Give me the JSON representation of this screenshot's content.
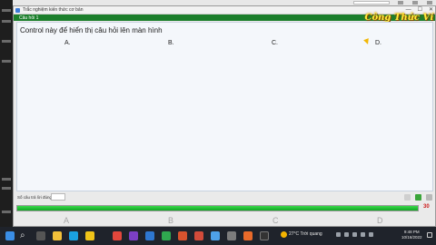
{
  "window": {
    "title": "Trắc nghiệm kiến thức cơ bản",
    "controls": {
      "minimize": "—",
      "maximize": "☐",
      "close": "✕"
    }
  },
  "header": {
    "question_number": "Câu hỏi 1",
    "brand": "Công Thức Ví"
  },
  "question": {
    "text": "Control này để hiển thị câu hỏi lên màn hình",
    "options": [
      "A.",
      "B.",
      "C.",
      "D."
    ]
  },
  "footer": {
    "answered_label": "Số câu trả lời đúng:",
    "answered_value": "",
    "progress_percent": 100,
    "progress_count": "30"
  },
  "answer_buttons": [
    "A",
    "B",
    "C",
    "D"
  ],
  "taskbar": {
    "weather": "27°C  Trời quang",
    "time": "9:48 PM",
    "date": "10/16/2022",
    "colors": {
      "start": "#3a8ee6",
      "explorer": "#f3c13a",
      "edge": "#1aa1e0",
      "vs": "#7b3fc4",
      "chrome": "#e3473c",
      "mail": "#2e77d0",
      "photos": "#d8532e"
    }
  },
  "colors": {
    "header_green": "#1c7f2c",
    "progress_green": "#12a524",
    "brand_yellow": "#ffeb3b",
    "count_red": "#cc1b1b"
  }
}
